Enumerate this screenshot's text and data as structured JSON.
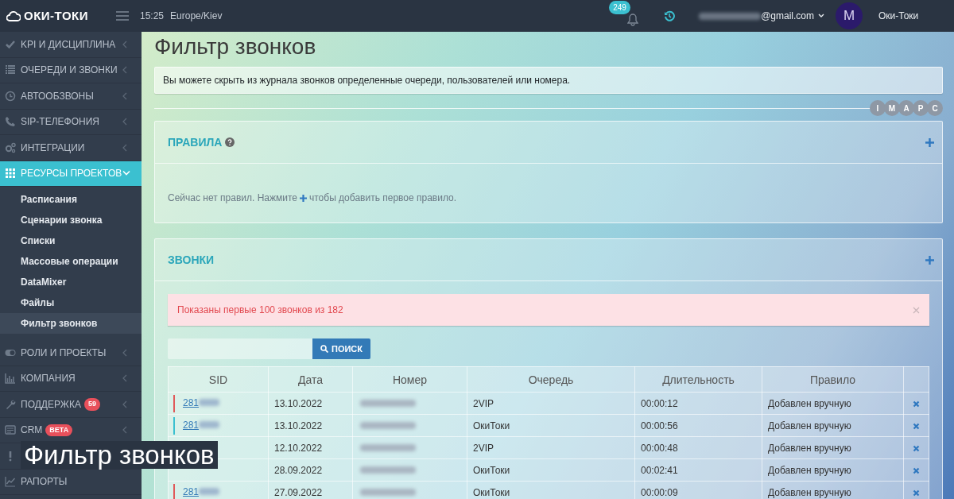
{
  "header": {
    "logo": "ОКИ-ТОКИ",
    "time": "15:25",
    "timezone": "Europe/Kiev",
    "notifications": "249",
    "email_hidden_part": true,
    "email": "@gmail.com",
    "avatar": "M",
    "account": "Оки-Токи"
  },
  "sidebar": {
    "items": [
      {
        "kind": "group",
        "label": "KPI И ДИСЦИПЛИНА",
        "selected": false,
        "expanded": false
      },
      {
        "kind": "group",
        "label": "ОЧЕРЕДИ И ЗВОНКИ",
        "selected": false,
        "expanded": false
      },
      {
        "kind": "group",
        "label": "АВТООБЗВОНЫ",
        "selected": false,
        "expanded": false
      },
      {
        "kind": "group",
        "label": "SIP-ТЕЛЕФОНИЯ",
        "selected": false,
        "expanded": false
      },
      {
        "kind": "group",
        "label": "ИНТЕГРАЦИИ",
        "selected": false,
        "expanded": false
      },
      {
        "kind": "group",
        "label": "РЕСУРСЫ ПРОЕКТОВ",
        "selected": true,
        "expanded": true,
        "children": [
          {
            "label": "Расписания",
            "selected": false
          },
          {
            "label": "Сценарии звонка",
            "selected": false
          },
          {
            "label": "Списки",
            "selected": false
          },
          {
            "label": "Массовые операции",
            "selected": false
          },
          {
            "label": "DataMixer",
            "selected": false
          },
          {
            "label": "Файлы",
            "selected": false
          },
          {
            "label": "Фильтр звонков",
            "selected": true
          }
        ]
      },
      {
        "kind": "group",
        "label": "РОЛИ И ПРОЕКТЫ",
        "selected": false,
        "expanded": false
      },
      {
        "kind": "group",
        "label": "КОМПАНИЯ",
        "selected": false,
        "expanded": false
      },
      {
        "kind": "group",
        "label": "ПОДДЕРЖКА",
        "selected": false,
        "expanded": false,
        "badge": {
          "text": "59",
          "color": "#e8505b"
        }
      },
      {
        "kind": "group",
        "label": "CRM",
        "selected": false,
        "expanded": false,
        "badge": {
          "text": "BETA",
          "color": "#e8505b"
        }
      },
      {
        "kind": "link",
        "selected": false
      },
      {
        "kind": "link",
        "label": "РАПОРТЫ",
        "selected": false
      }
    ]
  },
  "page": {
    "title": "Фильтр звонков",
    "info": "Вы можете скрыть из журнала звонков определенные очереди, пользователей или номера.",
    "filters": [
      "I",
      "M",
      "A",
      "P",
      "C"
    ]
  },
  "rules_panel": {
    "title": "ПРАВИЛА",
    "empty_before": "Сейчас нет правил. Нажмите",
    "empty_after": "чтобы добавить первое правило."
  },
  "calls_panel": {
    "title": "ЗВОНКИ",
    "alert": "Показаны первые 100 звонков из 182",
    "search_button": "ПОИСК",
    "table": {
      "columns": [
        "SID",
        "Дата",
        "Номер",
        "Очередь",
        "Длительность",
        "Правило"
      ],
      "rows": [
        {
          "sid": "281",
          "color": "#e05a5a",
          "date": "13.10.2022",
          "number_hidden": true,
          "queue": "2VIP",
          "duration": "00:00:12",
          "rule": "Добавлен вручную"
        },
        {
          "sid": "281",
          "color": "#3bc0d0",
          "date": "13.10.2022",
          "number_hidden": true,
          "queue": "ОкиТоки",
          "duration": "00:00:56",
          "rule": "Добавлен вручную"
        },
        {
          "date": "12.10.2022",
          "number_hidden": true,
          "queue": "2VIP",
          "duration": "00:00:48",
          "rule": "Добавлен вручную"
        },
        {
          "date": "28.09.2022",
          "number_hidden": true,
          "queue": "ОкиТоки",
          "duration": "00:02:41",
          "rule": "Добавлен вручную"
        },
        {
          "sid": "281",
          "color": "#e05a5a",
          "date": "27.09.2022",
          "number_hidden": true,
          "queue": "ОкиТоки",
          "duration": "00:00:09",
          "rule": "Добавлен вручную"
        }
      ]
    }
  },
  "caption": "Фильтр звонков"
}
